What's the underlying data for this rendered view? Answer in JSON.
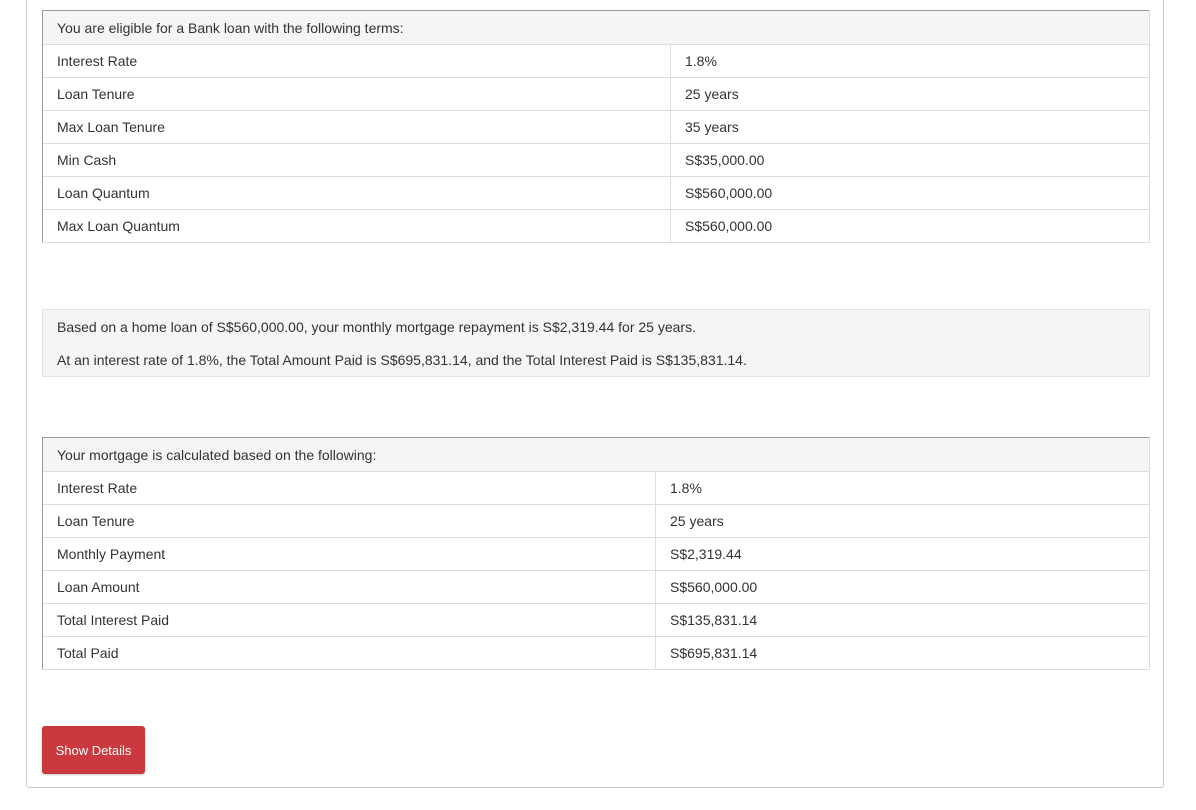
{
  "eligible": {
    "heading": "You are eligible for a Bank loan with the following terms:",
    "rows": [
      {
        "label": "Interest Rate",
        "value": "1.8%"
      },
      {
        "label": "Loan Tenure",
        "value": "25 years"
      },
      {
        "label": "Max Loan Tenure",
        "value": "35 years"
      },
      {
        "label": "Min Cash",
        "value": "S$35,000.00"
      },
      {
        "label": "Loan Quantum",
        "value": "S$560,000.00"
      },
      {
        "label": "Max Loan Quantum",
        "value": "S$560,000.00"
      }
    ]
  },
  "summary": {
    "line1": "Based on a home loan of S$560,000.00, your monthly mortgage repayment is S$2,319.44 for 25 years.",
    "line2": "At an interest rate of 1.8%, the Total Amount Paid is S$695,831.14, and the Total Interest Paid is S$135,831.14."
  },
  "mortgage": {
    "heading": "Your mortgage is calculated based on the following:",
    "rows": [
      {
        "label": "Interest Rate",
        "value": "1.8%"
      },
      {
        "label": "Loan Tenure",
        "value": "25 years"
      },
      {
        "label": "Monthly Payment",
        "value": "S$2,319.44"
      },
      {
        "label": "Loan Amount",
        "value": "S$560,000.00"
      },
      {
        "label": "Total Interest Paid",
        "value": "S$135,831.14"
      },
      {
        "label": "Total Paid",
        "value": "S$695,831.14"
      }
    ]
  },
  "actions": {
    "show_details_label": "Show Details"
  },
  "colors": {
    "button_bg": "#c9393e",
    "header_bg": "#f5f5f5"
  }
}
